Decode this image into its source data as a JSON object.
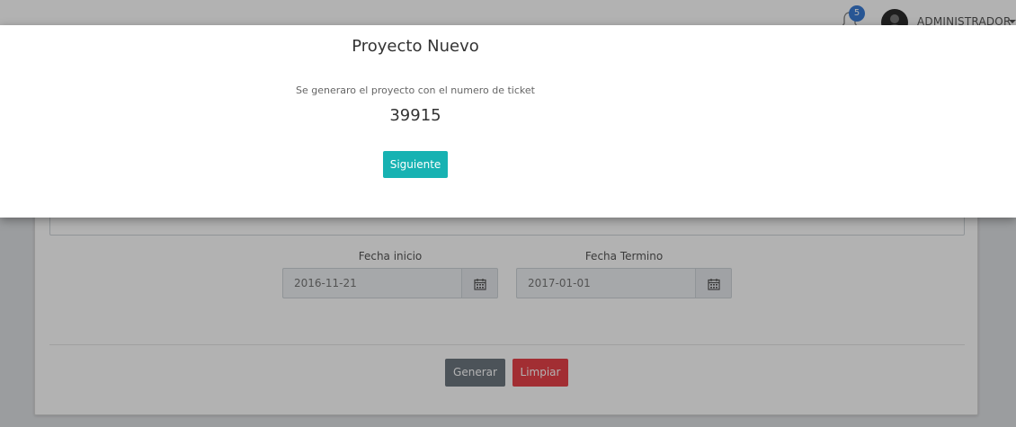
{
  "header": {
    "notifications_count": "5",
    "user_name": "ADMINISTRADOR",
    "icons": {
      "bell": "bell-icon",
      "caret": "caret-down-icon"
    }
  },
  "form": {
    "fecha_inicio": {
      "label": "Fecha inicio",
      "value": "2016-11-21",
      "icon": "calendar-icon"
    },
    "fecha_termino": {
      "label": "Fecha Termino",
      "value": "2017-01-01",
      "icon": "calendar-icon"
    },
    "generar_label": "Generar",
    "limpiar_label": "Limpiar"
  },
  "modal": {
    "title": "Proyecto Nuevo",
    "message": "Se generaro el proyecto con el numero de ticket",
    "ticket_number": "39915",
    "next_label": "Siguiente"
  },
  "colors": {
    "primary_teal": "#17b2b2",
    "danger": "#e8434a",
    "secondary": "#6e7780",
    "badge": "#3a7bd5"
  }
}
